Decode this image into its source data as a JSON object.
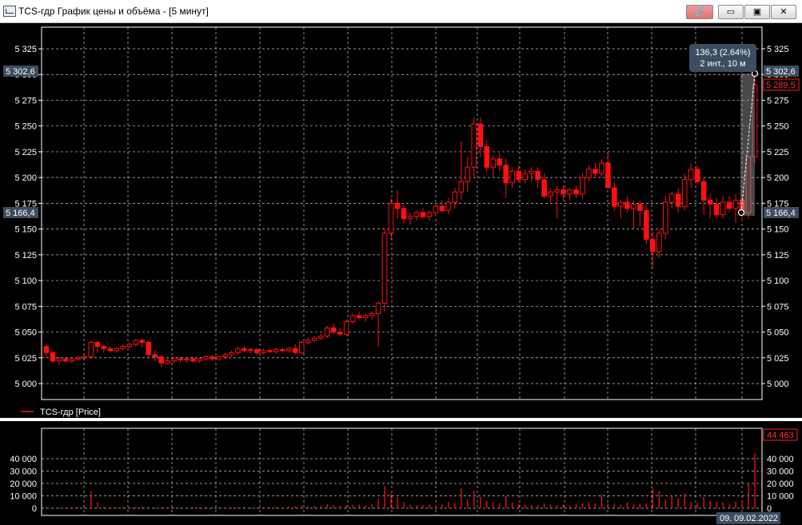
{
  "window": {
    "title": "TCS-гдр График цены и объёма - [5 минут]",
    "buttons": {
      "link": "🔗",
      "minimize": "▭",
      "maximize": "▣",
      "close": "✕"
    }
  },
  "colors": {
    "candle": "#ff1010",
    "grid": "#c8c8c8",
    "tag_bg": "#3a4a5c",
    "accent_red": "#ff2020"
  },
  "price_panel": {
    "y_ticks": [
      "5 325",
      "5 300",
      "5 275",
      "5 250",
      "5 225",
      "5 200",
      "5 175",
      "5 150",
      "5 125",
      "5 100",
      "5 075",
      "5 050",
      "5 025",
      "5 000"
    ],
    "left_tag_high": "5 302,6",
    "left_tag_low": "5 166,4",
    "right_tag_high": "5 302,6",
    "right_tag_last": "5 289,5",
    "right_tag_low": "5 166,4",
    "tooltip_line1": "136,3 (2.64%)",
    "tooltip_line2": "2 инт., 10 м",
    "legend": "TCS-гдр [Price]"
  },
  "volume_panel": {
    "y_ticks": [
      "40 000",
      "30 000",
      "20 000",
      "10 000",
      "0"
    ],
    "last_tag": "44 463",
    "date_left": "09.",
    "date_right": "09.02.2022"
  },
  "chart_data": [
    {
      "type": "candlestick",
      "ylim": [
        4990,
        5340
      ],
      "y_ticks": [
        5000,
        5025,
        5050,
        5075,
        5100,
        5125,
        5150,
        5175,
        5200,
        5225,
        5250,
        5275,
        5300,
        5325
      ],
      "ohlc": [
        [
          5036,
          5038,
          5025,
          5030
        ],
        [
          5030,
          5032,
          5020,
          5022
        ],
        [
          5022,
          5026,
          5018,
          5024
        ],
        [
          5024,
          5026,
          5020,
          5022
        ],
        [
          5022,
          5025,
          5020,
          5024
        ],
        [
          5024,
          5027,
          5022,
          5025
        ],
        [
          5025,
          5028,
          5023,
          5026
        ],
        [
          5026,
          5042,
          5024,
          5040
        ],
        [
          5040,
          5042,
          5030,
          5036
        ],
        [
          5036,
          5038,
          5030,
          5034
        ],
        [
          5034,
          5036,
          5030,
          5032
        ],
        [
          5032,
          5036,
          5030,
          5034
        ],
        [
          5034,
          5038,
          5032,
          5036
        ],
        [
          5036,
          5040,
          5034,
          5038
        ],
        [
          5038,
          5043,
          5036,
          5042
        ],
        [
          5042,
          5044,
          5035,
          5040
        ],
        [
          5040,
          5042,
          5025,
          5028
        ],
        [
          5028,
          5032,
          5022,
          5026
        ],
        [
          5026,
          5028,
          5016,
          5020
        ],
        [
          5020,
          5024,
          5018,
          5022
        ],
        [
          5022,
          5026,
          5020,
          5024
        ],
        [
          5024,
          5026,
          5020,
          5023
        ],
        [
          5023,
          5026,
          5020,
          5024
        ],
        [
          5024,
          5026,
          5020,
          5022
        ],
        [
          5022,
          5025,
          5020,
          5024
        ],
        [
          5024,
          5027,
          5022,
          5026
        ],
        [
          5026,
          5028,
          5022,
          5024
        ],
        [
          5024,
          5027,
          5022,
          5026
        ],
        [
          5026,
          5030,
          5024,
          5028
        ],
        [
          5028,
          5032,
          5026,
          5030
        ],
        [
          5030,
          5036,
          5028,
          5034
        ],
        [
          5034,
          5036,
          5030,
          5032
        ],
        [
          5032,
          5035,
          5029,
          5033
        ],
        [
          5033,
          5035,
          5028,
          5030
        ],
        [
          5030,
          5034,
          5028,
          5032
        ],
        [
          5032,
          5034,
          5030,
          5031
        ],
        [
          5031,
          5035,
          5029,
          5033
        ],
        [
          5033,
          5035,
          5030,
          5032
        ],
        [
          5032,
          5036,
          5030,
          5034
        ],
        [
          5034,
          5038,
          5028,
          5030
        ],
        [
          5030,
          5042,
          5028,
          5040
        ],
        [
          5040,
          5045,
          5038,
          5042
        ],
        [
          5042,
          5046,
          5040,
          5044
        ],
        [
          5044,
          5048,
          5042,
          5046
        ],
        [
          5046,
          5056,
          5044,
          5054
        ],
        [
          5054,
          5058,
          5048,
          5050
        ],
        [
          5050,
          5054,
          5046,
          5048
        ],
        [
          5048,
          5062,
          5046,
          5060
        ],
        [
          5060,
          5068,
          5058,
          5066
        ],
        [
          5066,
          5070,
          5062,
          5064
        ],
        [
          5064,
          5068,
          5060,
          5066
        ],
        [
          5066,
          5070,
          5062,
          5068
        ],
        [
          5068,
          5080,
          5036,
          5078
        ],
        [
          5078,
          5150,
          5070,
          5146
        ],
        [
          5146,
          5180,
          5140,
          5175
        ],
        [
          5175,
          5188,
          5160,
          5170
        ],
        [
          5170,
          5174,
          5155,
          5160
        ],
        [
          5160,
          5166,
          5154,
          5162
        ],
        [
          5162,
          5168,
          5158,
          5166
        ],
        [
          5166,
          5170,
          5160,
          5162
        ],
        [
          5162,
          5168,
          5158,
          5166
        ],
        [
          5166,
          5175,
          5162,
          5172
        ],
        [
          5172,
          5178,
          5166,
          5168
        ],
        [
          5168,
          5180,
          5164,
          5176
        ],
        [
          5176,
          5190,
          5170,
          5186
        ],
        [
          5186,
          5235,
          5178,
          5196
        ],
        [
          5196,
          5220,
          5186,
          5210
        ],
        [
          5210,
          5258,
          5200,
          5252
        ],
        [
          5252,
          5258,
          5220,
          5230
        ],
        [
          5230,
          5236,
          5205,
          5210
        ],
        [
          5210,
          5222,
          5200,
          5218
        ],
        [
          5218,
          5224,
          5206,
          5212
        ],
        [
          5212,
          5218,
          5180,
          5195
        ],
        [
          5195,
          5210,
          5190,
          5206
        ],
        [
          5206,
          5212,
          5196,
          5198
        ],
        [
          5198,
          5208,
          5194,
          5204
        ],
        [
          5204,
          5210,
          5196,
          5206
        ],
        [
          5206,
          5210,
          5190,
          5198
        ],
        [
          5198,
          5204,
          5180,
          5182
        ],
        [
          5182,
          5190,
          5176,
          5186
        ],
        [
          5186,
          5192,
          5160,
          5188
        ],
        [
          5188,
          5192,
          5178,
          5184
        ],
        [
          5184,
          5190,
          5178,
          5188
        ],
        [
          5188,
          5192,
          5180,
          5184
        ],
        [
          5184,
          5204,
          5180,
          5200
        ],
        [
          5200,
          5212,
          5196,
          5208
        ],
        [
          5208,
          5214,
          5200,
          5204
        ],
        [
          5204,
          5218,
          5200,
          5214
        ],
        [
          5214,
          5226,
          5200,
          5190
        ],
        [
          5190,
          5196,
          5168,
          5172
        ],
        [
          5172,
          5178,
          5160,
          5176
        ],
        [
          5176,
          5182,
          5166,
          5170
        ],
        [
          5170,
          5178,
          5150,
          5174
        ],
        [
          5174,
          5178,
          5152,
          5168
        ],
        [
          5168,
          5174,
          5135,
          5140
        ],
        [
          5140,
          5148,
          5112,
          5128
        ],
        [
          5128,
          5150,
          5122,
          5146
        ],
        [
          5146,
          5182,
          5140,
          5176
        ],
        [
          5176,
          5186,
          5170,
          5184
        ],
        [
          5184,
          5190,
          5166,
          5172
        ],
        [
          5172,
          5204,
          5168,
          5198
        ],
        [
          5198,
          5214,
          5190,
          5208
        ],
        [
          5208,
          5212,
          5194,
          5196
        ],
        [
          5196,
          5200,
          5164,
          5178
        ],
        [
          5178,
          5184,
          5160,
          5174
        ],
        [
          5174,
          5180,
          5160,
          5164
        ],
        [
          5164,
          5182,
          5160,
          5176
        ],
        [
          5176,
          5182,
          5166,
          5170
        ],
        [
          5170,
          5184,
          5156,
          5178
        ],
        [
          5178,
          5190,
          5158,
          5166
        ],
        [
          5166,
          5190,
          5160,
          5220
        ],
        [
          5220,
          5302,
          5214,
          5289.5
        ]
      ]
    },
    {
      "type": "bar",
      "name": "volume",
      "ylim": [
        0,
        50000
      ],
      "y_ticks": [
        0,
        10000,
        20000,
        30000,
        40000
      ],
      "values": [
        1200,
        800,
        600,
        700,
        900,
        1000,
        1300,
        14000,
        4500,
        1100,
        900,
        1000,
        1200,
        900,
        1100,
        1400,
        1000,
        800,
        900,
        700,
        600,
        700,
        800,
        900,
        1000,
        1100,
        900,
        800,
        700,
        800,
        900,
        1000,
        800,
        700,
        900,
        800,
        1100,
        1000,
        1200,
        1500,
        2000,
        1600,
        1800,
        2200,
        3200,
        2400,
        2000,
        2600,
        3000,
        2800,
        2400,
        3200,
        8000,
        18000,
        12000,
        9000,
        5000,
        3000,
        2500,
        2800,
        3200,
        2600,
        3500,
        5000,
        4000,
        16000,
        7000,
        14000,
        9000,
        6000,
        4500,
        4000,
        10000,
        4500,
        3500,
        3000,
        2800,
        2500,
        4000,
        3000,
        2600,
        2800,
        2400,
        3200,
        4000,
        5000,
        4000,
        11000,
        3500,
        4000,
        3000,
        4500,
        3000,
        3500,
        4000,
        16000,
        14000,
        7000,
        10000,
        8000,
        12000,
        5000,
        4000,
        9000,
        6000,
        5000,
        4500,
        3000,
        5500,
        6500,
        20000,
        44463
      ]
    }
  ]
}
